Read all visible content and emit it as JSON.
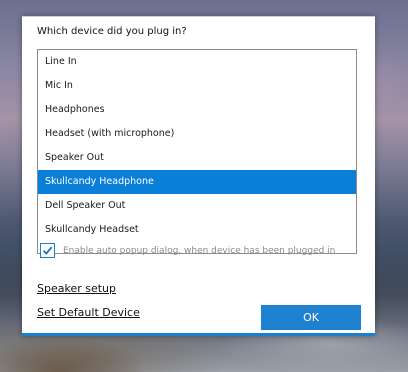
{
  "dialog": {
    "prompt": "Which device did you plug in?",
    "devices": [
      "Line In",
      "Mic In",
      "Headphones",
      "Headset (with microphone)",
      "Speaker Out",
      "Skullcandy Headphone",
      "Dell Speaker Out",
      "Skullcandy Headset"
    ],
    "selected_device": "Skullcandy Headphone",
    "auto_popup": {
      "label": "Enable auto popup dialog, when device has been plugged in",
      "checked": true
    },
    "speaker_setup_link": "Speaker setup",
    "set_default_link": "Set Default Device",
    "ok_label": "OK",
    "accent_color": "#0a7fd8"
  }
}
